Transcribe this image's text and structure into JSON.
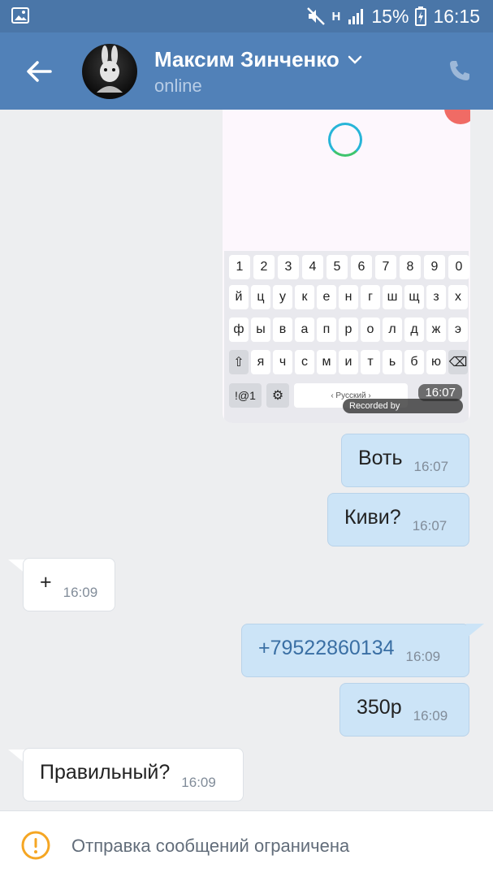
{
  "status_bar": {
    "battery": "15%",
    "time": "16:15",
    "network": "H"
  },
  "header": {
    "contact_name": "Максим Зинченко",
    "contact_status": "online"
  },
  "image_message": {
    "time": "16:07",
    "recorded_by": "Recorded by",
    "keyboard": {
      "row1": [
        "1",
        "2",
        "3",
        "4",
        "5",
        "6",
        "7",
        "8",
        "9",
        "0"
      ],
      "row2": [
        "й",
        "ц",
        "у",
        "к",
        "е",
        "н",
        "г",
        "ш",
        "щ",
        "з",
        "х"
      ],
      "row3": [
        "ф",
        "ы",
        "в",
        "а",
        "п",
        "р",
        "о",
        "л",
        "д",
        "ж",
        "э"
      ],
      "row4": [
        "⇧",
        "я",
        "ч",
        "с",
        "м",
        "и",
        "т",
        "ь",
        "б",
        "ю",
        "⌫"
      ],
      "symbols_key": "!@1",
      "space_label": "‹ Русский ›"
    }
  },
  "messages": [
    {
      "direction": "out",
      "text": "Воть",
      "time": "16:07"
    },
    {
      "direction": "out",
      "text": "Киви?",
      "time": "16:07"
    },
    {
      "direction": "in",
      "text": "+",
      "time": "16:09"
    },
    {
      "direction": "out",
      "text": "+79522860134",
      "time": "16:09"
    },
    {
      "direction": "out",
      "text": "350р",
      "time": "16:09"
    },
    {
      "direction": "in",
      "text": "Правильный?",
      "time": "16:09"
    }
  ],
  "bottom_bar": {
    "text": "Отправка сообщений ограничена"
  },
  "colors": {
    "header_bg": "#5181b8",
    "status_bg": "#4a76a8",
    "out_bubble": "#cce4f7",
    "in_bubble": "#ffffff",
    "warning": "#f5a623"
  }
}
